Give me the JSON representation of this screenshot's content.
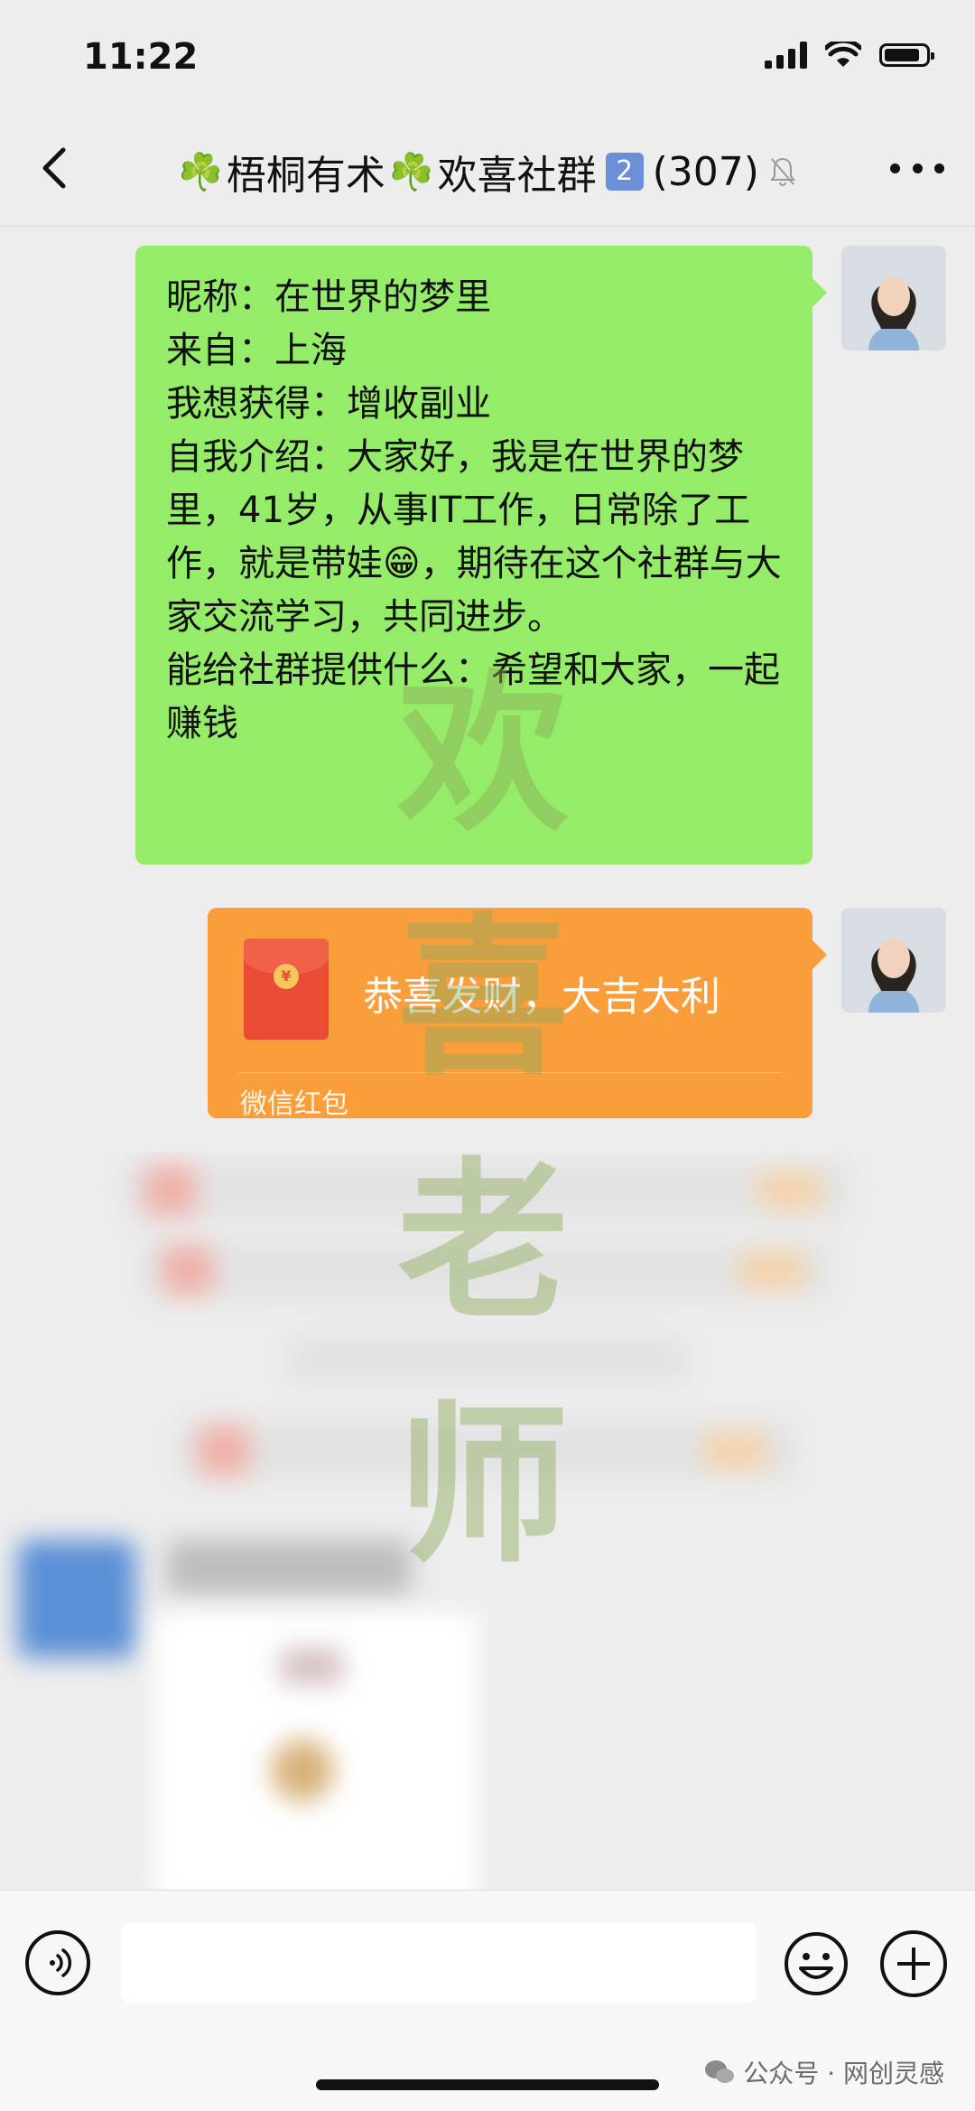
{
  "status": {
    "time": "11:22"
  },
  "header": {
    "clover": "☘️",
    "title_main": "梧桐有术",
    "title_mid": "欢喜社群",
    "badge_number": "2",
    "member_count": "(307)"
  },
  "messages": {
    "intro_text": "昵称：在世界的梦里\n来自：上海\n我想获得：增收副业\n自我介绍：大家好，我是在世界的梦里，41岁，从事IT工作，日常除了工作，就是带娃😁，期待在这个社群与大家交流学习，共同进步。\n能给社群提供什么：希望和大家，一起赚钱",
    "red_packet": {
      "greeting": "恭喜发财，大吉大利",
      "label": "微信红包",
      "coin_symbol": "¥"
    }
  },
  "watermark": [
    "欢",
    "喜",
    "老",
    "师"
  ],
  "footer": {
    "source": "公众号 · 网创灵感"
  },
  "colors": {
    "bubble_green": "#95ec69",
    "red_packet_orange": "#fa9d3b",
    "background": "#ededed"
  }
}
